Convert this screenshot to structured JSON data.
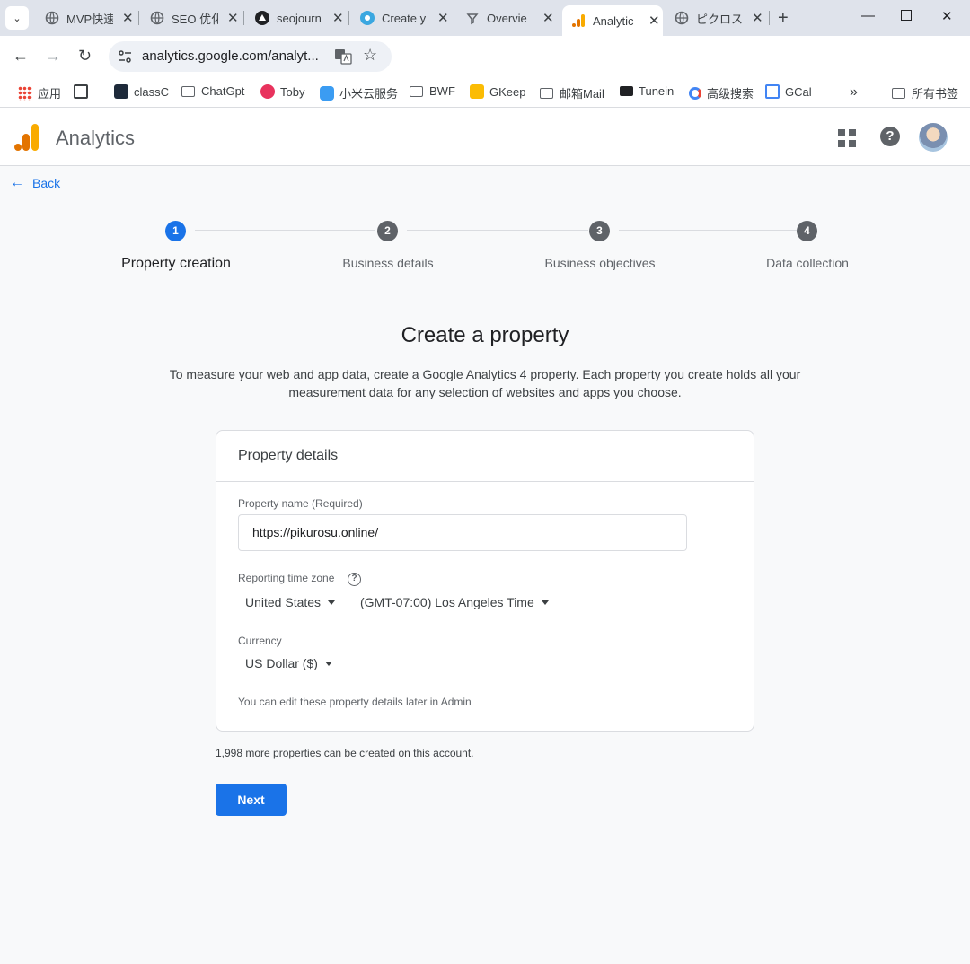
{
  "browser": {
    "tabs": [
      {
        "title": "MVP快速",
        "active": false
      },
      {
        "title": "SEO 优化",
        "active": false
      },
      {
        "title": "seojourn",
        "active": false
      },
      {
        "title": "Create y",
        "active": false
      },
      {
        "title": "Overvie",
        "active": false
      },
      {
        "title": "Analytic",
        "active": true
      },
      {
        "title": "ピクロス",
        "active": false
      }
    ],
    "url": "analytics.google.com/analyt...",
    "extension_badge": "58",
    "bookmarks": [
      "应用",
      "classC",
      "ChatGpt",
      "Toby",
      "小米云服务",
      "BWF",
      "GKeep",
      "邮箱Mail",
      "Tunein",
      "高级搜索",
      "GCal"
    ],
    "bookmarks_more": "»",
    "all_bookmarks": "所有书签"
  },
  "header": {
    "app_name": "Analytics"
  },
  "back_label": "Back",
  "steps": [
    {
      "number": "1",
      "label": "Property creation",
      "active": true
    },
    {
      "number": "2",
      "label": "Business details",
      "active": false
    },
    {
      "number": "3",
      "label": "Business objectives",
      "active": false
    },
    {
      "number": "4",
      "label": "Data collection",
      "active": false
    }
  ],
  "page": {
    "title": "Create a property",
    "intro": "To measure your web and app data, create a Google Analytics 4 property. Each property you create holds all your measurement data for any selection of websites and apps you choose."
  },
  "card": {
    "title": "Property details",
    "property_name_label": "Property name (Required)",
    "property_name_value": "https://pikurosu.online/",
    "timezone_label": "Reporting time zone",
    "country": "United States",
    "timezone": "(GMT-07:00) Los Angeles Time",
    "currency_label": "Currency",
    "currency": "US Dollar ($)",
    "note": "You can edit these property details later in Admin"
  },
  "remaining": "1,998 more properties can be created on this account.",
  "next_label": "Next",
  "colors": {
    "accent": "#1a73e8",
    "logo_orange": "#f9ab00",
    "logo_dark": "#e37400"
  }
}
